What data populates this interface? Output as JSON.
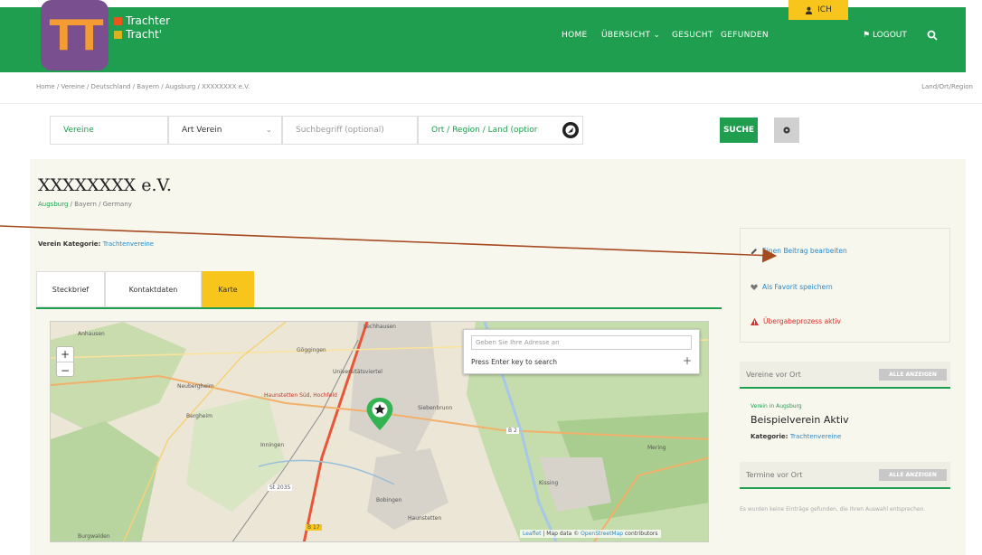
{
  "brand": {
    "logo_text": "TT",
    "line1": "Trachter",
    "line2": "Tracht'",
    "color1": "#e8561d",
    "color2": "#d5b321"
  },
  "nav": {
    "items": [
      "HOME",
      "ÜBERSICHT ⌄",
      "GESUCHT",
      "GEFUNDEN"
    ],
    "user_label": "ICH",
    "logout_label": "LOGOUT",
    "search_icon": "search-icon"
  },
  "breadcrumb": {
    "path": "Home / Vereine / Deutschland / Bayern / Augsburg / XXXXXXXX e.V.",
    "right": "Land/Ort/Region"
  },
  "search": {
    "vereine": "Vereine",
    "art": "Art Verein",
    "art_arrow": "⌄",
    "keyword_placeholder": "Suchbegriff (optional)",
    "region": "Ort / Region / Land (optior",
    "submit": "SUCHE"
  },
  "club": {
    "title": "XXXXXXXX e.V.",
    "loc_link": "Augsburg",
    "loc_rest": " / Bayern / Germany",
    "kat_label": "Verein Kategorie: ",
    "kat_value": "Trachtenvereine"
  },
  "tabs": [
    "Steckbrief",
    "Kontaktdaten",
    "Karte"
  ],
  "map": {
    "zoom_in": "+",
    "zoom_out": "−",
    "geo_placeholder": "Geben Sie Ihre Adresse an",
    "geo_hint": "Press Enter key to search",
    "geo_plus": "+",
    "attribution_link": "Leaflet",
    "attribution_text": " | Map data © ",
    "attribution_osm": "OpenStreetMap",
    "attribution_end": " contributors",
    "labels": [
      "Anhausen",
      "Göggingen",
      "Universitätsviertel",
      "Neubergheim",
      "Haunstetten Süd, Hochfeld",
      "Lechhausen",
      "Bergheim",
      "Inningen",
      "St 2035",
      "Siebenbrunn",
      "Haunstetten",
      "Bobingen",
      "Burgwalden",
      "Kissing",
      "Mering",
      "B 17",
      "B 2"
    ]
  },
  "sidebar": {
    "edit": "Einen Beitrag bearbeiten",
    "favorite": "Als Favorit speichern",
    "transfer": "Übergabeprozess aktiv",
    "vereine_hdr": "Vereine vor Ort",
    "show_all": "ALLE ANZEIGEN",
    "item_small": "Verein in Augsburg",
    "item_title": "Beispielverein Aktiv",
    "item_kat_label": "Kategorie: ",
    "item_kat_value": "Trachtenvereine",
    "termine_hdr": "Termine vor Ort",
    "no_results": "Es wurden keine Einträge gefunden, die Ihren Auswahl entsprechen."
  },
  "colors": {
    "green": "#1f9e4f",
    "yellow": "#f7c51c",
    "purple": "#7a4f8f",
    "red": "#d9302a",
    "arrow": "#a64a20"
  }
}
